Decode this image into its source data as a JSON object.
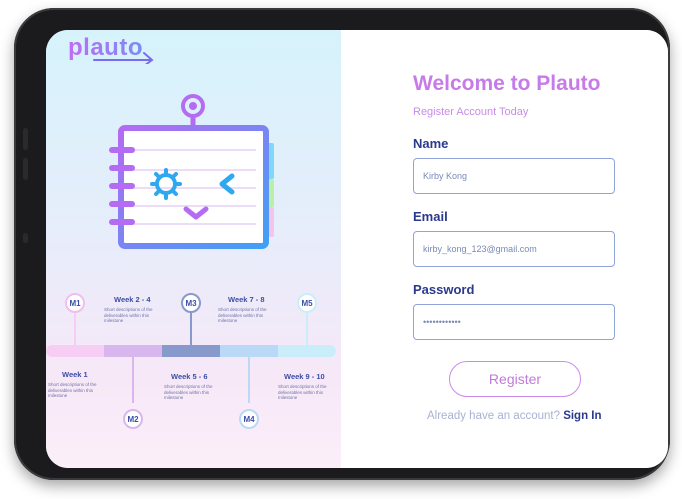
{
  "brand": {
    "logo": "plauto"
  },
  "timeline": {
    "weeks": [
      {
        "label": "Week 1",
        "desc": "Short descriptions of the deliverables within this milestone"
      },
      {
        "label": "Week 2 - 4",
        "desc": "Short descriptions of the deliverables within this milestone"
      },
      {
        "label": "Week 5 - 6",
        "desc": "Short descriptions of the deliverables within this milestone"
      },
      {
        "label": "Week 7 - 8",
        "desc": "Short descriptions of the deliverables within this milestone"
      },
      {
        "label": "Week 9 - 10",
        "desc": "Short descriptions of the deliverables within this milestone"
      }
    ],
    "milestones": [
      "M1",
      "M2",
      "M3",
      "M4",
      "M5"
    ],
    "colors": [
      "#f7cdf3",
      "#d8b6ee",
      "#8899cc",
      "#b9d9f7",
      "#c9eefa"
    ]
  },
  "form": {
    "title": "Welcome to Plauto",
    "subtitle": "Register Account Today",
    "name_label": "Name",
    "name_value": "Kirby Kong",
    "email_label": "Email",
    "email_value": "kirby_kong_123@gmail.com",
    "password_label": "Password",
    "password_value": "••••••••••••",
    "register_label": "Register",
    "signin_prompt": "Already have an account?",
    "signin_link": "Sign In"
  },
  "colors": {
    "accent": "#c77be9",
    "navy": "#2a3a8c",
    "field_border": "#8fa4d8"
  }
}
